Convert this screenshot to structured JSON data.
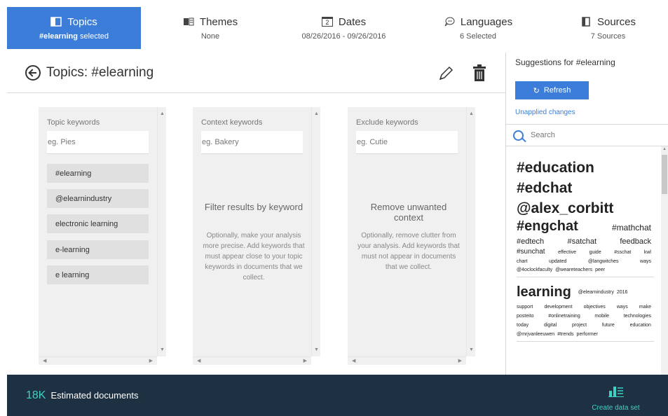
{
  "colors": {
    "accent": "#3b7dd8",
    "footer_bg": "#1e3142",
    "teal": "#3fd1c4"
  },
  "nav": {
    "tabs": [
      {
        "label": "Topics",
        "sub_bold": "#elearning",
        "sub": " selected",
        "icon": "topics-icon"
      },
      {
        "label": "Themes",
        "sub": "None",
        "icon": "themes-icon"
      },
      {
        "label": "Dates",
        "sub": "08/26/2016 - 09/26/2016",
        "icon": "calendar-icon",
        "icon_text": "2"
      },
      {
        "label": "Languages",
        "sub": "6 Selected",
        "icon": "languages-icon"
      },
      {
        "label": "Sources",
        "sub": "7 Sources",
        "icon": "sources-icon"
      }
    ]
  },
  "main": {
    "title": "Topics: #elearning",
    "panels": {
      "topic": {
        "label": "Topic keywords",
        "placeholder": "eg. Pies",
        "chips": [
          "#elearning",
          "@elearnindustry",
          "electronic learning",
          "e-learning",
          "e learning"
        ]
      },
      "context": {
        "label": "Context keywords",
        "placeholder": "eg. Bakery",
        "help_title": "Filter results by keyword",
        "help_text": "Optionally, make your analysis more precise. Add keywords that must appear close to your topic keywords in documents that we collect."
      },
      "exclude": {
        "label": "Exclude keywords",
        "placeholder": "eg. Cutie",
        "help_title": "Remove unwanted context",
        "help_text": "Optionally, remove clutter from your analysis. Add keywords that must not appear in documents that we collect."
      }
    }
  },
  "sidebar": {
    "title": "Suggestions for #elearning",
    "refresh_label": "Refresh",
    "unapplied": "Unapplied changes",
    "search_placeholder": "Search",
    "cloud1": {
      "big": [
        "#education",
        "#edchat",
        "@alex_corbitt"
      ],
      "l4a": "#engchat",
      "l4b": "#mathchat",
      "l5": [
        "#edtech",
        "#satchat",
        "feedback"
      ],
      "l6": [
        "#sunchat",
        "effective",
        "guide",
        "#sschat",
        "kwl"
      ],
      "l7": [
        "chart",
        "updated",
        "@langwitches",
        "ways"
      ],
      "l8": [
        "@4oclockfaculty",
        "@weareteachers",
        "peer"
      ]
    },
    "cloud2": {
      "l1a": "learning",
      "l1b": "@elearnindustry",
      "l1c": "2016",
      "l2": [
        "support",
        "development",
        "objectives",
        "ways",
        "make"
      ],
      "l3": [
        "posteito",
        "#onlinetraining",
        "mobile",
        "technologies"
      ],
      "l4": [
        "today",
        "digital",
        "project",
        "future",
        "education"
      ],
      "l5": [
        "@mrjvanleeuwen",
        "#trends",
        "performer"
      ]
    }
  },
  "footer": {
    "count": "18K",
    "label": "Estimated documents",
    "create_label": "Create data set"
  }
}
